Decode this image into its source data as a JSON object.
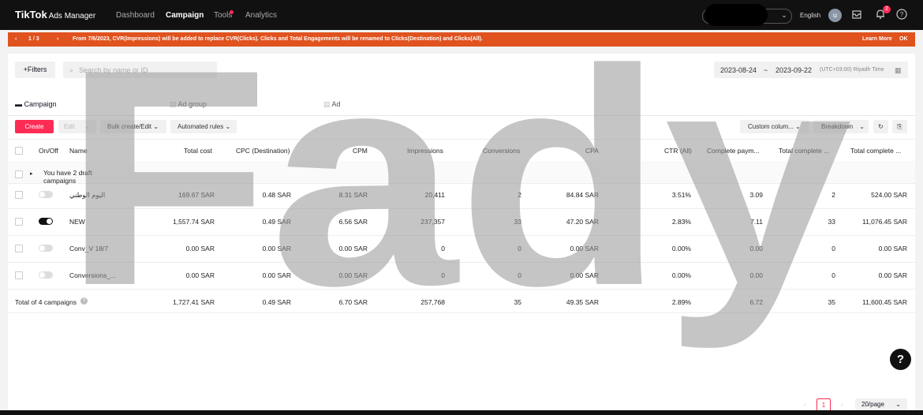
{
  "brand": {
    "name": "TikTok",
    "sub": "Ads Manager"
  },
  "nav": [
    "Dashboard",
    "Campaign",
    "Tools",
    "Analytics"
  ],
  "top": {
    "language": "English",
    "avatar": "u",
    "notifications": "2"
  },
  "banner": {
    "pager": "1 / 3",
    "message": "From 7/6/2023, CVR(Impressions) will be added to replace CVR(Clicks). Clicks and Total Engagements will be renamed to Clicks(Destination) and Clicks(All).",
    "learn_more": "Learn More",
    "ok": "OK"
  },
  "toolbar": {
    "filters": "+Filters",
    "search_placeholder": "Search by name or ID",
    "date_from": "2023-08-24",
    "date_sep": "~",
    "date_to": "2023-09-22",
    "timezone": "(UTC+03:00) Riyadh Time"
  },
  "tabs": [
    "Campaign",
    "Ad group",
    "Ad"
  ],
  "actions": {
    "create": "Create",
    "edit": "Edit",
    "bulk": "Bulk create/Edit",
    "automated": "Automated rules",
    "custom_columns": "Custom colum...",
    "breakdown": "Breakdown"
  },
  "table": {
    "headers": [
      "On/Off",
      "Name",
      "Total cost",
      "CPC (Destination)",
      "CPM",
      "Impressions",
      "Conversions",
      "CPA",
      "CTR (All)",
      "Complete paym...",
      "Total complete ...",
      "Total complete ..."
    ],
    "draft_note": "You have 2 draft campaigns",
    "rows": [
      {
        "on": false,
        "name": "اليوم الوطني",
        "cost": "169.67 SAR",
        "cpc": "0.48 SAR",
        "cpm": "8.31 SAR",
        "impr": "20,411",
        "conv": "2",
        "cpa": "84.84 SAR",
        "ctr": "3.51%",
        "pay": "3.09",
        "tc1": "2",
        "tc2": "524.00 SAR"
      },
      {
        "on": true,
        "name": "NEW",
        "cost": "1,557.74 SAR",
        "cpc": "0.49 SAR",
        "cpm": "6.56 SAR",
        "impr": "237,357",
        "conv": "33",
        "cpa": "47.20 SAR",
        "ctr": "2.83%",
        "pay": "7.11",
        "tc1": "33",
        "tc2": "11,076.45 SAR"
      },
      {
        "on": false,
        "name": "Conv_V 18/7",
        "cost": "0.00 SAR",
        "cpc": "0.00 SAR",
        "cpm": "0.00 SAR",
        "impr": "0",
        "conv": "0",
        "cpa": "0.00 SAR",
        "ctr": "0.00%",
        "pay": "0.00",
        "tc1": "0",
        "tc2": "0.00 SAR"
      },
      {
        "on": false,
        "name": "Conversions_...",
        "cost": "0.00 SAR",
        "cpc": "0.00 SAR",
        "cpm": "0.00 SAR",
        "impr": "0",
        "conv": "0",
        "cpa": "0.00 SAR",
        "ctr": "0.00%",
        "pay": "0.00",
        "tc1": "0",
        "tc2": "0.00 SAR"
      }
    ],
    "total": {
      "label": "Total of 4 campaigns",
      "cost": "1,727.41 SAR",
      "cpc": "0.49 SAR",
      "cpm": "6.70 SAR",
      "impr": "257,768",
      "conv": "35",
      "cpa": "49.35 SAR",
      "ctr": "2.89%",
      "pay": "6.72",
      "tc1": "35",
      "tc2": "11,600.45 SAR"
    }
  },
  "pager": {
    "current": "1",
    "per_page": "20/page"
  },
  "watermark": "Fady",
  "colors": {
    "accent": "#fe2c55",
    "banner": "#e0521e",
    "topbar": "#111111"
  }
}
